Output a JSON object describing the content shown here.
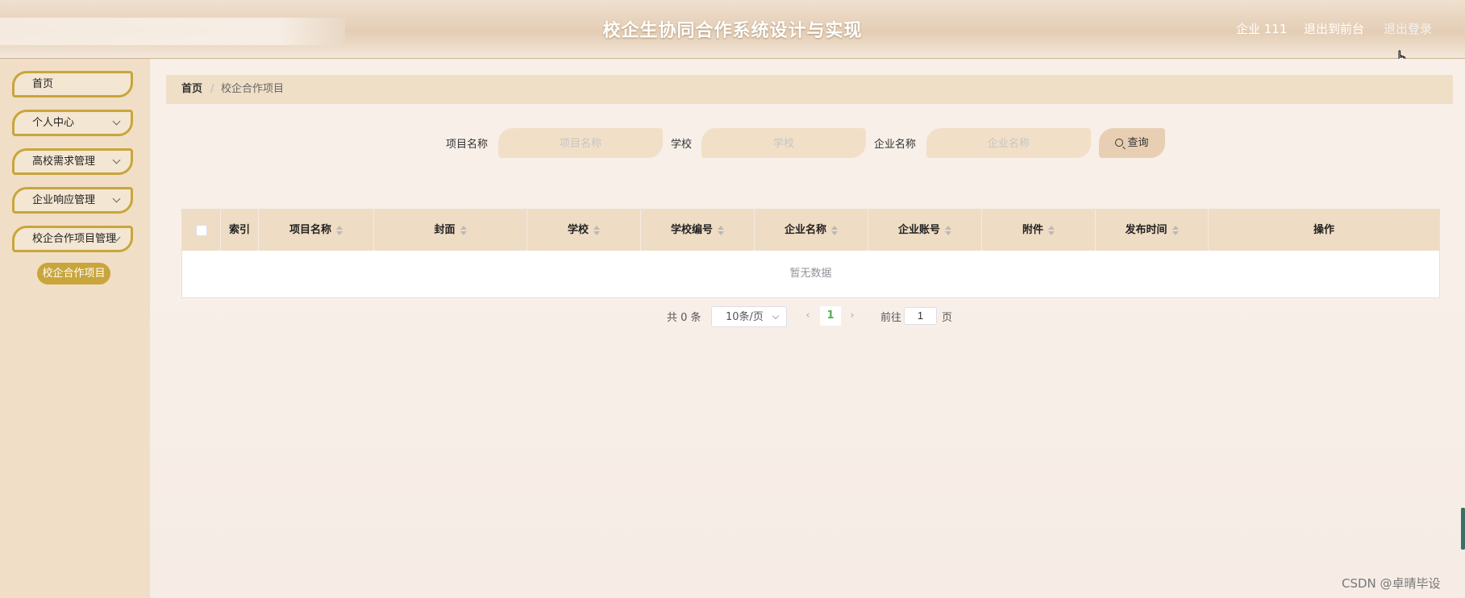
{
  "header": {
    "title": "校企生协同合作系统设计与实现",
    "user": "企业 111",
    "front_link": "退出到前台",
    "logout_link": "退出登录"
  },
  "sidebar": {
    "items": [
      {
        "label": "首页"
      },
      {
        "label": "个人中心"
      },
      {
        "label": "高校需求管理"
      },
      {
        "label": "企业响应管理"
      },
      {
        "label": "校企合作项目管理"
      }
    ],
    "sub_item": "校企合作项目"
  },
  "breadcrumb": {
    "home": "首页",
    "separator": "/",
    "current": "校企合作项目"
  },
  "search": {
    "project_label": "项目名称",
    "project_placeholder": "项目名称",
    "school_label": "学校",
    "school_placeholder": "学校",
    "company_label": "企业名称",
    "company_placeholder": "企业名称",
    "button": "查询"
  },
  "table": {
    "columns": [
      "索引",
      "项目名称",
      "封面",
      "学校",
      "学校编号",
      "企业名称",
      "企业账号",
      "附件",
      "发布时间",
      "操作"
    ],
    "empty_text": "暂无数据"
  },
  "pagination": {
    "total": "共 0 条",
    "page_size": "10条/页",
    "current_page": "1",
    "goto_label": "前往",
    "goto_value": "1",
    "page_suffix": "页"
  },
  "watermark": "CSDN @卓晴毕设",
  "colors": {
    "accent": "#c9a53c",
    "header_bg": "#e4cdb4",
    "sidebar_bg": "#f0dfc6",
    "table_header_bg": "#efdcc4"
  }
}
